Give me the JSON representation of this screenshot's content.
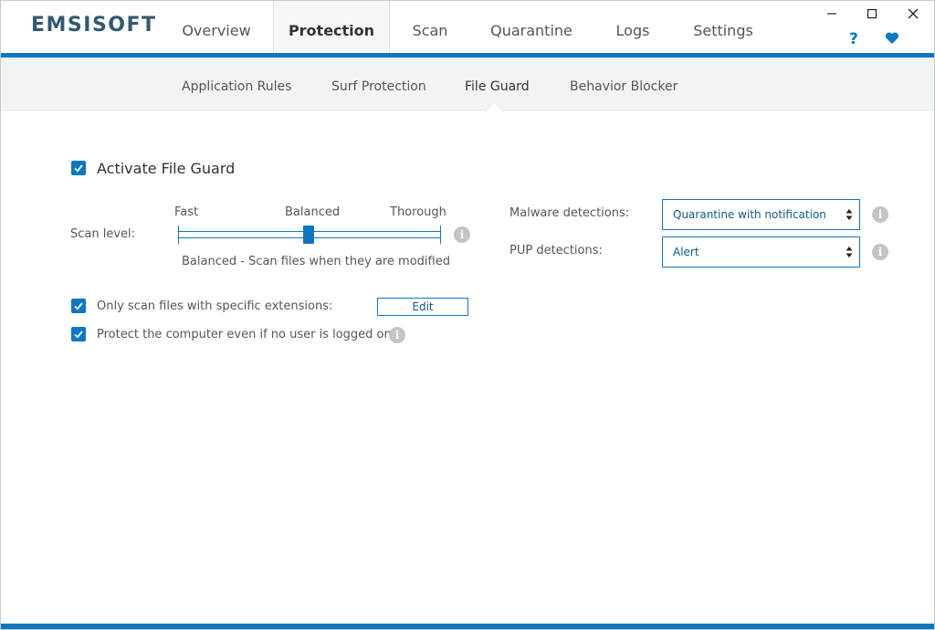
{
  "app": {
    "logo": "EMSISOFT"
  },
  "main_tabs": [
    {
      "label": "Overview"
    },
    {
      "label": "Protection"
    },
    {
      "label": "Scan"
    },
    {
      "label": "Quarantine"
    },
    {
      "label": "Logs"
    },
    {
      "label": "Settings"
    }
  ],
  "header_icons": {
    "help": "?",
    "heart": "❤"
  },
  "window_controls": {
    "minimize": "—",
    "maximize": "☐",
    "close": "✕"
  },
  "sub_tabs": [
    {
      "label": "Application Rules"
    },
    {
      "label": "Surf Protection"
    },
    {
      "label": "File Guard"
    },
    {
      "label": "Behavior Blocker"
    }
  ],
  "file_guard": {
    "activate_label": "Activate File Guard",
    "activate_checked": true,
    "scan_level": {
      "label": "Scan level:",
      "options": [
        "Fast",
        "Balanced",
        "Thorough"
      ],
      "selected": "Balanced",
      "description": "Balanced - Scan files when they are modified"
    },
    "malware": {
      "label": "Malware detections:",
      "value": "Quarantine with notification"
    },
    "pup": {
      "label": "PUP detections:",
      "value": "Alert"
    },
    "extensions": {
      "label": "Only scan files with specific extensions:",
      "checked": true,
      "edit_label": "Edit"
    },
    "no_user": {
      "label": "Protect the computer even if no user is logged on",
      "checked": true
    }
  },
  "colors": {
    "accent": "#0e77c1",
    "logo": "#315a73",
    "info": "#c4c4c4"
  }
}
